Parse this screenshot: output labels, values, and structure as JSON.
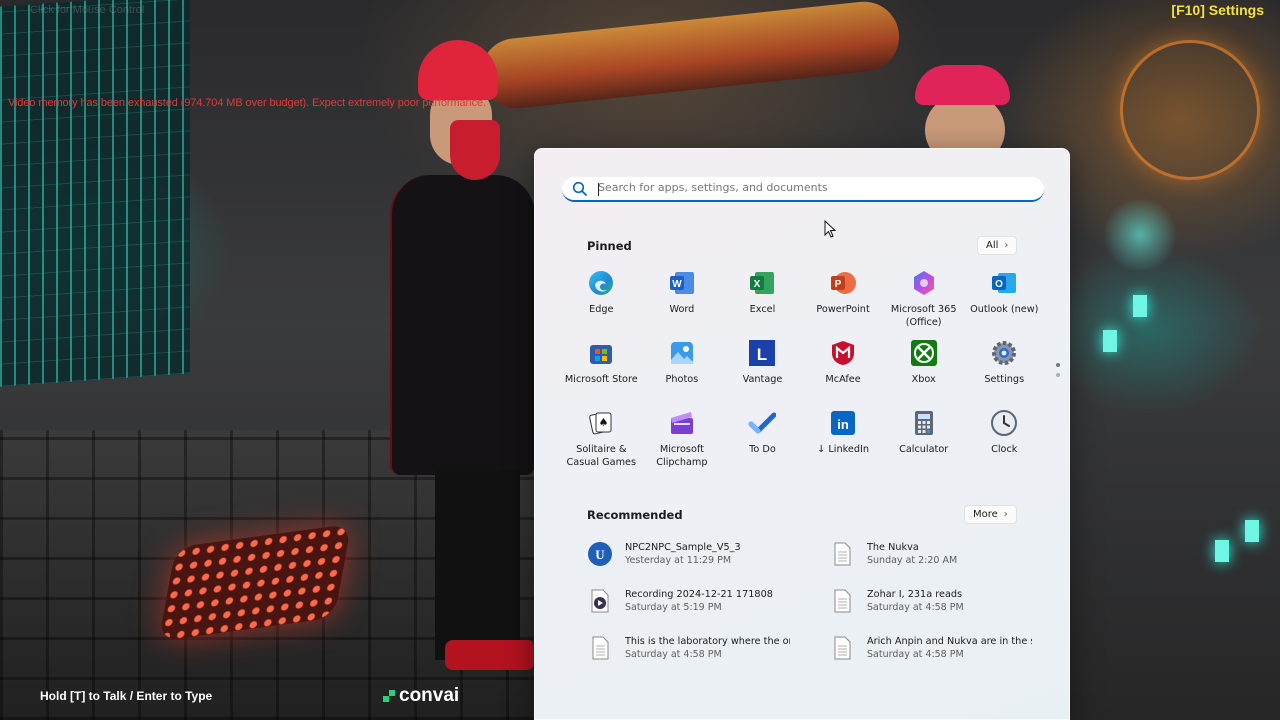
{
  "game": {
    "faded_title": "Click for Mouse Control",
    "warning": "Video memory has been exhausted (974.704 MB over budget). Expect extremely poor performance.",
    "settings_hint": "[F10] Settings",
    "talk_hint": "Hold [T] to Talk / Enter to Type",
    "brand": "convai"
  },
  "start_menu": {
    "search": {
      "placeholder": "Search for apps, settings, and documents"
    },
    "pinned": {
      "title": "Pinned",
      "all_label": "All",
      "apps": [
        {
          "label": "Edge",
          "icon": "edge-icon"
        },
        {
          "label": "Word",
          "icon": "word-icon"
        },
        {
          "label": "Excel",
          "icon": "excel-icon"
        },
        {
          "label": "PowerPoint",
          "icon": "powerpoint-icon"
        },
        {
          "label": "Microsoft 365 (Office)",
          "icon": "microsoft-365-icon"
        },
        {
          "label": "Outlook (new)",
          "icon": "outlook-icon"
        },
        {
          "label": "Microsoft Store",
          "icon": "microsoft-store-icon"
        },
        {
          "label": "Photos",
          "icon": "photos-icon"
        },
        {
          "label": "Vantage",
          "icon": "vantage-icon"
        },
        {
          "label": "McAfee",
          "icon": "mcafee-icon"
        },
        {
          "label": "Xbox",
          "icon": "xbox-icon"
        },
        {
          "label": "Settings",
          "icon": "settings-gear-icon"
        },
        {
          "label": "Solitaire & Casual Games",
          "icon": "solitaire-icon"
        },
        {
          "label": "Microsoft Clipchamp",
          "icon": "clipchamp-icon"
        },
        {
          "label": "To Do",
          "icon": "todo-check-icon"
        },
        {
          "label": "↓ LinkedIn",
          "icon": "linkedin-icon"
        },
        {
          "label": "Calculator",
          "icon": "calculator-icon"
        },
        {
          "label": "Clock",
          "icon": "clock-icon"
        }
      ]
    },
    "recommended": {
      "title": "Recommended",
      "more_label": "More",
      "items": [
        {
          "name": "NPC2NPC_Sample_V5_3",
          "time": "Yesterday at 11:29 PM",
          "icon": "unreal-engine-icon"
        },
        {
          "name": "The Nukva",
          "time": "Sunday at 2:20 AM",
          "icon": "document-icon"
        },
        {
          "name": "Recording 2024-12-21 171808",
          "time": "Saturday at 5:19 PM",
          "icon": "video-file-icon"
        },
        {
          "name": "Zohar I, 231a reads",
          "time": "Saturday at 4:58 PM",
          "icon": "document-icon"
        },
        {
          "name": "This is the laboratory where the or",
          "time": "Saturday at 4:58 PM",
          "icon": "document-icon"
        },
        {
          "name": "Arich Anpin and Nukva are in the se",
          "time": "Saturday at 4:58 PM",
          "icon": "document-icon"
        }
      ]
    }
  },
  "colors": {
    "accent": "#0067c0",
    "warning": "#e03a3a",
    "settings_hint": "#f5e23a",
    "convai_green": "#29d17a"
  }
}
